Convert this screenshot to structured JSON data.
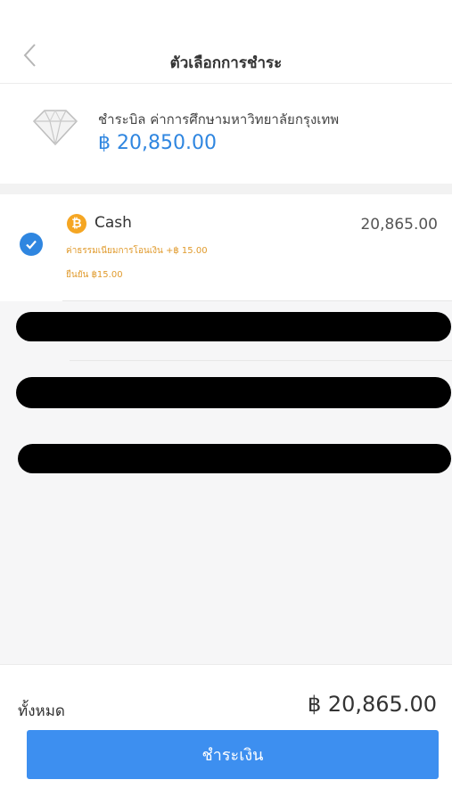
{
  "header": {
    "title": "ตัวเลือกการชำระ"
  },
  "bill": {
    "description": "ชำระบิล ค่าการศึกษามหาวิทยาลัยกรุงเทพ",
    "amount": "฿ 20,850.00",
    "icon": "diamond-icon"
  },
  "payment_option": {
    "selected": true,
    "icon": "bitcoin-coin-icon",
    "coin_symbol": "₿",
    "name": "Cash",
    "amount": "20,865.00",
    "fee_text": "ค่าธรรมเนียมการโอนเงิน +฿ 15.00",
    "total_text": "ยืนยัน ฿15.00"
  },
  "footer": {
    "total_label": "ทั้งหมด",
    "total_amount": "฿ 20,865.00",
    "pay_button_label": "ชำระเงิน"
  },
  "colors": {
    "accent": "#3d8ff0",
    "amount_blue": "#2f86e0",
    "fee_orange": "#e09a2c",
    "coin_orange": "#f5a623",
    "redaction": "#000000"
  }
}
